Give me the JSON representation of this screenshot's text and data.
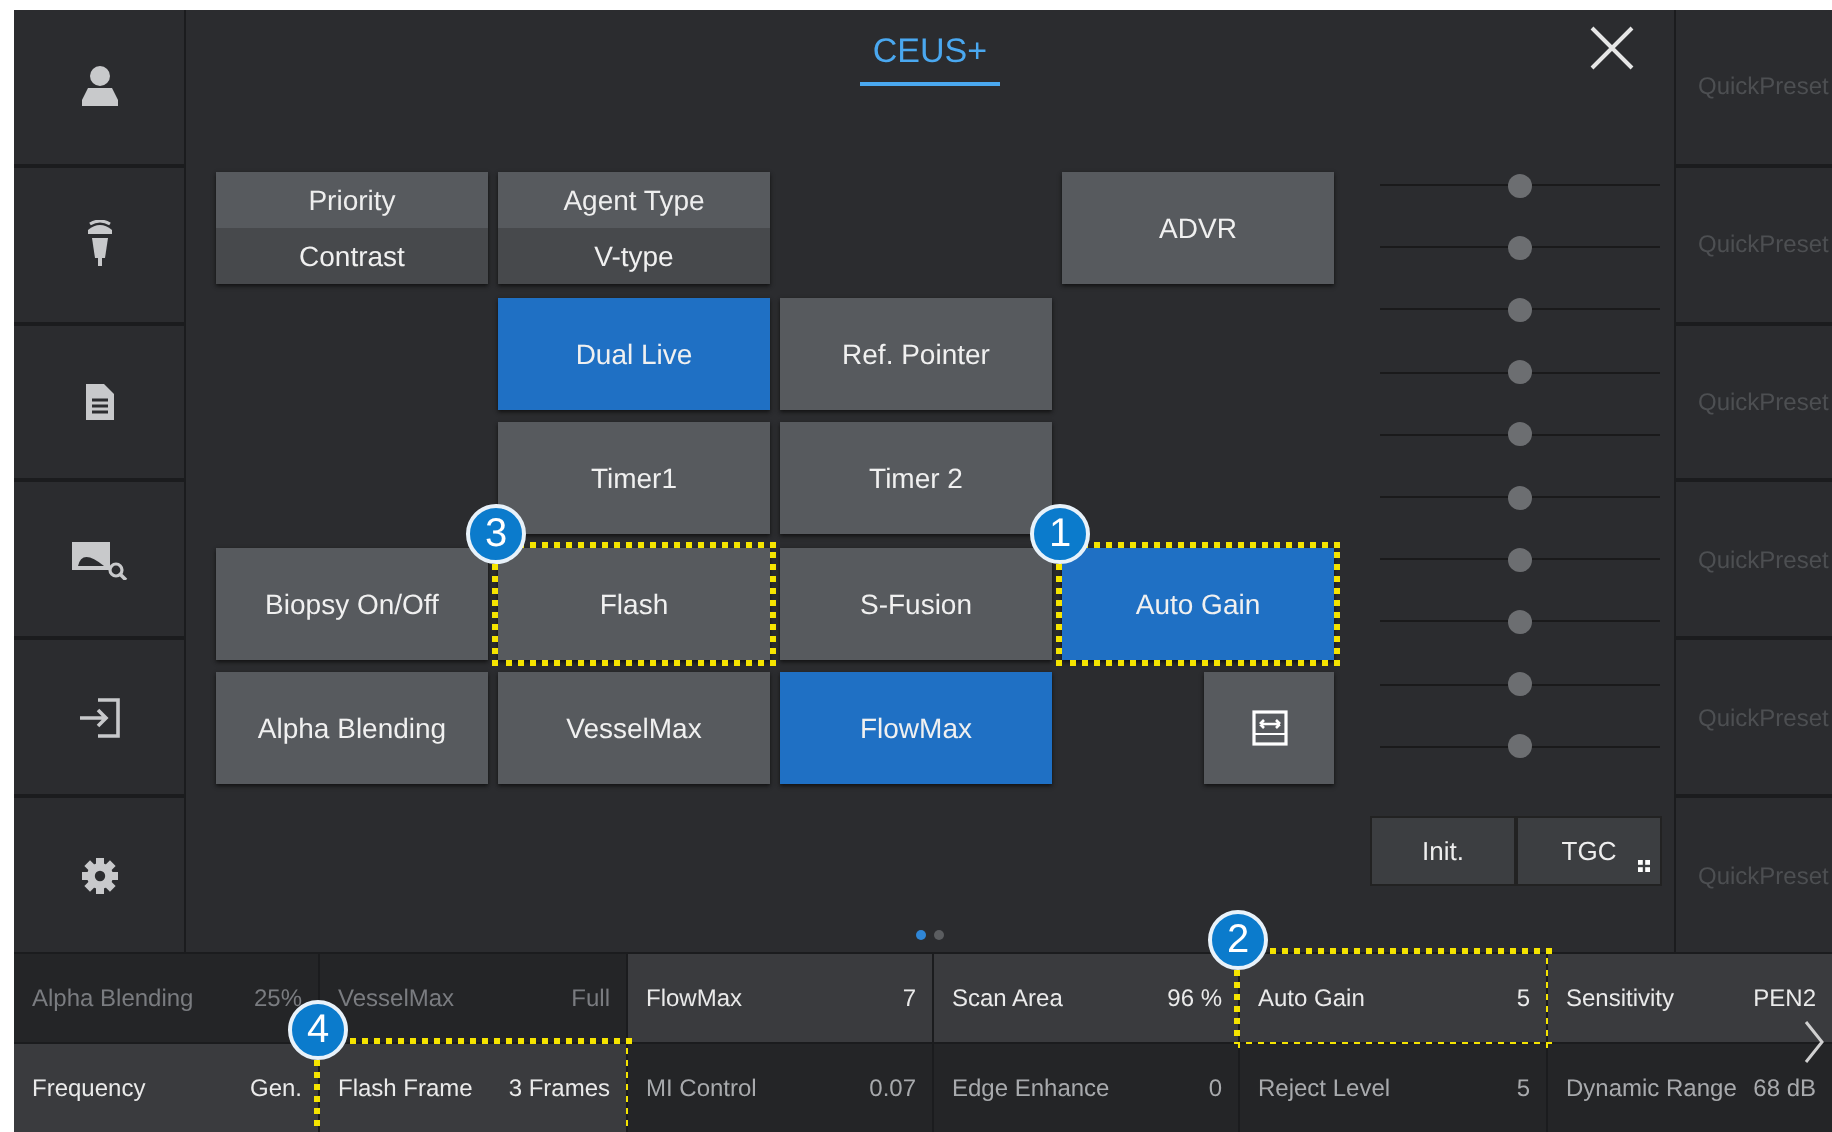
{
  "tabs": [
    {
      "label": "CEUS+",
      "selected": true
    }
  ],
  "button_rows": [
    [
      {
        "kind": "split",
        "label": "Priority",
        "value": "Contrast"
      },
      {
        "kind": "split",
        "label": "Agent Type",
        "value": "V-type"
      },
      {
        "kind": "blank"
      },
      {
        "kind": "button",
        "label": "ADVR",
        "on": false
      }
    ],
    [
      {
        "kind": "blank"
      },
      {
        "kind": "button",
        "label": "Dual Live",
        "on": true
      },
      {
        "kind": "button",
        "label": "Ref. Pointer",
        "on": false
      },
      {
        "kind": "blank"
      }
    ],
    [
      {
        "kind": "blank"
      },
      {
        "kind": "button",
        "label": "Timer1",
        "on": false
      },
      {
        "kind": "button",
        "label": "Timer 2",
        "on": false
      },
      {
        "kind": "blank"
      }
    ],
    [
      {
        "kind": "button",
        "label": "Biopsy On/Off",
        "on": false
      },
      {
        "kind": "button",
        "label": "Flash",
        "on": false,
        "callout": "3"
      },
      {
        "kind": "button",
        "label": "S-Fusion",
        "on": false
      },
      {
        "kind": "button",
        "label": "Auto Gain",
        "on": true,
        "callout": "1"
      }
    ],
    [
      {
        "kind": "button",
        "label": "Alpha Blending",
        "on": false
      },
      {
        "kind": "button",
        "label": "VesselMax",
        "on": false
      },
      {
        "kind": "button",
        "label": "FlowMax",
        "on": true
      },
      {
        "kind": "icon"
      }
    ]
  ],
  "tgc": {
    "sliders": [
      {
        "level": 0.5
      },
      {
        "level": 0.5
      },
      {
        "level": 0.5
      },
      {
        "level": 0.5
      },
      {
        "level": 0.5
      },
      {
        "level": 0.5
      },
      {
        "level": 0.5
      },
      {
        "level": 0.5
      },
      {
        "level": 0.5
      },
      {
        "level": 0.5
      }
    ],
    "buttons": [
      {
        "label": "Init.",
        "kind": "plain"
      },
      {
        "label": "TGC",
        "kind": "grid"
      }
    ]
  },
  "pages": [
    {
      "selected": true
    },
    {
      "selected": false
    }
  ],
  "quick_presets": [
    "QuickPreset",
    "QuickPreset",
    "QuickPreset",
    "QuickPreset",
    "QuickPreset",
    "QuickPreset"
  ],
  "parameter_rows": [
    [
      {
        "label": "Alpha Blending",
        "value": "25%",
        "disabled": true,
        "highlighted": false
      },
      {
        "label": "VesselMax",
        "value": "Full",
        "disabled": true,
        "highlighted": false
      },
      {
        "label": "FlowMax",
        "value": "7",
        "disabled": false,
        "highlighted": true
      },
      {
        "label": "Scan Area",
        "value": "96 %",
        "disabled": false,
        "highlighted": true
      },
      {
        "label": "Auto Gain",
        "value": "5",
        "disabled": false,
        "highlighted": true,
        "callout": "2"
      },
      {
        "label": "Sensitivity",
        "value": "PEN2",
        "disabled": false,
        "highlighted": true
      }
    ],
    [
      {
        "label": "Frequency",
        "value": "Gen.",
        "disabled": false,
        "highlighted": true
      },
      {
        "label": "Flash Frame",
        "value": "3 Frames",
        "disabled": false,
        "highlighted": true,
        "callout": "4"
      },
      {
        "label": "MI Control",
        "value": "0.07",
        "disabled": false,
        "highlighted": false
      },
      {
        "label": "Edge Enhance",
        "value": "0",
        "disabled": false,
        "highlighted": false
      },
      {
        "label": "Reject Level",
        "value": "5",
        "disabled": false,
        "highlighted": false
      },
      {
        "label": "Dynamic Range",
        "value": "68 dB",
        "disabled": false,
        "highlighted": false
      }
    ]
  ]
}
